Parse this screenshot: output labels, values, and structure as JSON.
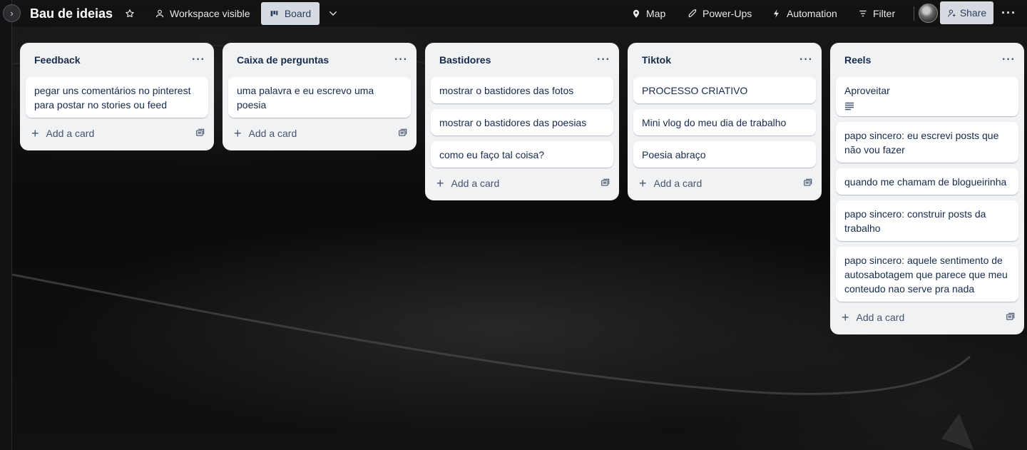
{
  "board": {
    "title": "Bau de ideias",
    "visibility": "Workspace visible",
    "view": "Board"
  },
  "toolbar": {
    "map": "Map",
    "power_ups": "Power-Ups",
    "automation": "Automation",
    "filter": "Filter",
    "share": "Share"
  },
  "lists": [
    {
      "title": "Feedback",
      "cards": [
        "pegar uns comentários no pinterest para postar no stories ou feed"
      ],
      "add_label": "Add a card"
    },
    {
      "title": "Caixa de perguntas",
      "cards": [
        "uma palavra e eu escrevo uma poesia"
      ],
      "add_label": "Add a card"
    },
    {
      "title": "Bastidores",
      "cards": [
        "mostrar o bastidores das fotos",
        "mostrar o bastidores das poesias",
        "como eu faço tal coisa?"
      ],
      "add_label": "Add a card"
    },
    {
      "title": "Tiktok",
      "cards": [
        "PROCESSO CRIATIVO",
        "Mini vlog do meu dia de trabalho",
        "Poesia abraço"
      ],
      "add_label": "Add a card"
    },
    {
      "title": "Reels",
      "cards": [
        "Aproveitar",
        "papo sincero: eu escrevi posts que não vou fazer",
        "quando me chamam de blogueirinha",
        "papo sincero: construir posts da trabalho",
        "papo sincero: aquele sentimento de autosabotagem que parece que meu conteudo nao serve pra nada"
      ],
      "add_label": "Add a card"
    }
  ]
}
